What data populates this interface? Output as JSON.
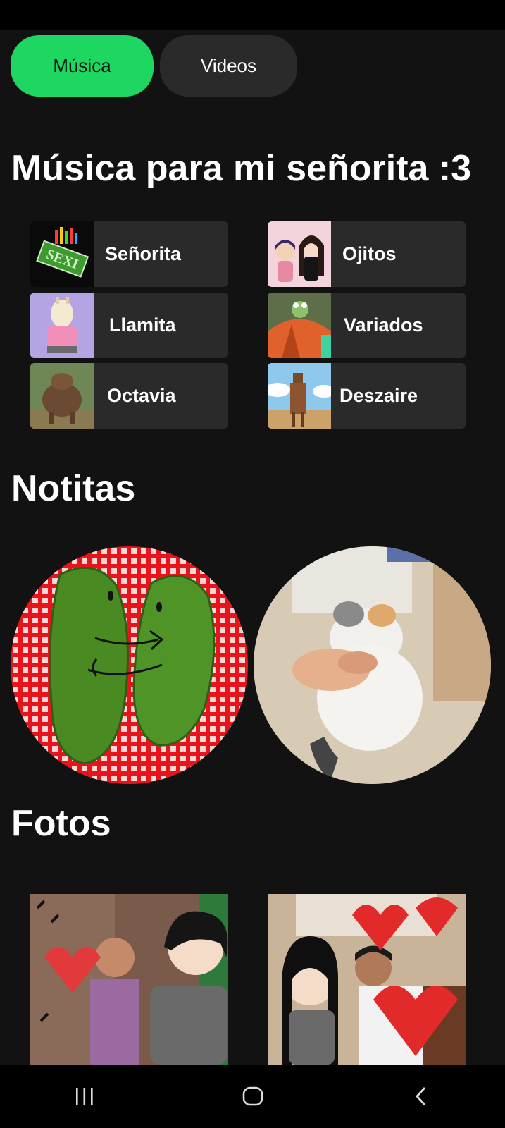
{
  "tabs": {
    "music": "Música",
    "videos": "Videos"
  },
  "sections": {
    "music_title": "Música para mi señorita :3",
    "notes_title": "Notitas",
    "photos_title": "Fotos"
  },
  "playlists": [
    {
      "label": "Señorita",
      "thumb_text": "SEXI"
    },
    {
      "label": "Ojitos"
    },
    {
      "label": "Llamita"
    },
    {
      "label": "Variados"
    },
    {
      "label": "Octavia"
    },
    {
      "label": "Deszaire"
    }
  ],
  "colors": {
    "accent": "#1ed760",
    "background": "#121212",
    "card": "#2a2a2a"
  },
  "nav": {
    "icons": [
      "recents-icon",
      "home-icon",
      "back-icon"
    ]
  }
}
